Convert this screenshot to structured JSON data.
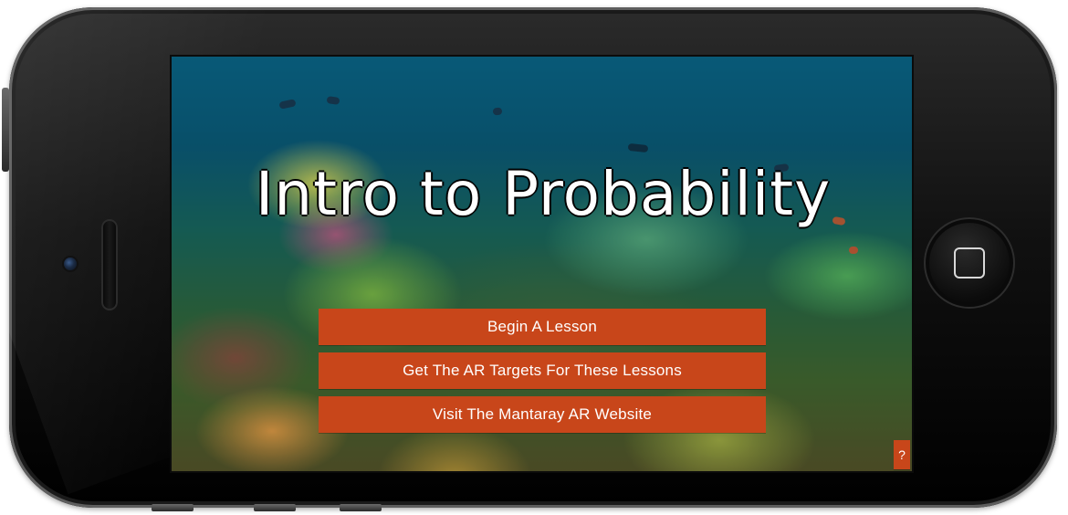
{
  "app": {
    "title": "Intro to Probability"
  },
  "menu": {
    "items": [
      {
        "label": "Begin A Lesson"
      },
      {
        "label": "Get The AR Targets For These Lessons"
      },
      {
        "label": "Visit The Mantaray AR Website"
      }
    ]
  },
  "help": {
    "label": "?"
  },
  "colors": {
    "button_bg": "#c8461a",
    "button_text": "#ffffff",
    "title_text": "#ffffff"
  },
  "icons": {
    "home_button": "home-button-icon",
    "camera": "front-camera-icon",
    "speaker": "earpiece-speaker-icon"
  }
}
